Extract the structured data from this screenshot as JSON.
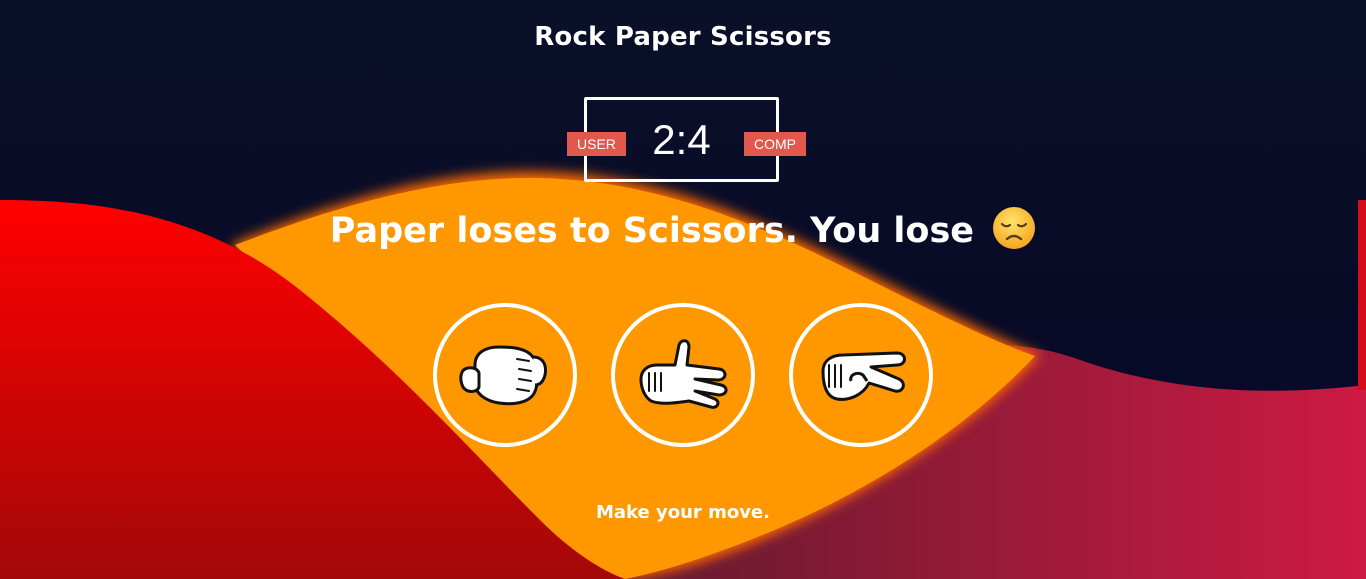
{
  "title": "Rock Paper Scissors",
  "scoreboard": {
    "user_label": "USER",
    "comp_label": "COMP",
    "score": "2:4"
  },
  "result": {
    "message": "Paper loses to Scissors. You lose",
    "emoji": "disappointed-face"
  },
  "choices": [
    {
      "name": "rock",
      "icon": "fist-glove-icon"
    },
    {
      "name": "paper",
      "icon": "open-hand-glove-icon"
    },
    {
      "name": "scissors",
      "icon": "two-finger-glove-icon"
    }
  ],
  "prompt": "Make your move.",
  "colors": {
    "background": "#0b1029",
    "red": "#ff0000",
    "orange": "#ff9800",
    "crimson": "#c8193f",
    "badge": "#e2584d"
  }
}
